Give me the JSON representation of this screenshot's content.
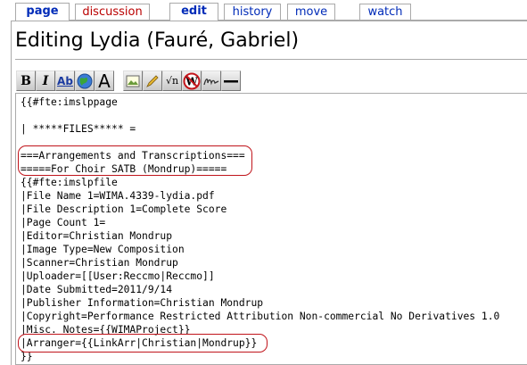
{
  "tabs": [
    {
      "label": "page",
      "state": "active"
    },
    {
      "label": "discussion",
      "state": "redlink"
    },
    {
      "label": "edit",
      "state": "active"
    },
    {
      "label": "history",
      "state": "normal"
    },
    {
      "label": "move",
      "state": "normal"
    },
    {
      "label": "watch",
      "state": "normal"
    }
  ],
  "title": "Editing Lydia (Fauré, Gabriel)",
  "toolbar": {
    "buttons": [
      {
        "name": "bold-button",
        "glyph": "B"
      },
      {
        "name": "italic-button",
        "glyph": "I"
      },
      {
        "name": "internal-link-button",
        "glyph": "Ab"
      },
      {
        "name": "external-link-button",
        "glyph": "globe-icon"
      },
      {
        "name": "headline-button",
        "glyph": "A"
      },
      {
        "name": "embedded-image-button",
        "glyph": "image-icon"
      },
      {
        "name": "media-link-button",
        "glyph": "pencil-icon"
      },
      {
        "name": "math-formula-button",
        "glyph": "√n"
      },
      {
        "name": "nowiki-button",
        "glyph": "W"
      },
      {
        "name": "signature-button",
        "glyph": "signature-icon"
      },
      {
        "name": "horizontal-line-button",
        "glyph": "—"
      }
    ]
  },
  "editor": {
    "lines": [
      "{{#fte:imslppage",
      "",
      "| *****FILES***** =",
      "",
      "===Arrangements and Transcriptions===",
      "=====For Choir SATB (Mondrup)=====",
      "{{#fte:imslpfile",
      "|File Name 1=WIMA.4339-lydia.pdf",
      "|File Description 1=Complete Score",
      "|Page Count 1=",
      "|Editor=Christian Mondrup",
      "|Image Type=New Composition",
      "|Scanner=Christian Mondrup",
      "|Uploader=[[User:Reccmo|Reccmo]]",
      "|Date Submitted=2011/9/14",
      "|Publisher Information=Christian Mondrup",
      "|Copyright=Performance Restricted Attribution Non-commercial No Derivatives 1.0",
      "|Misc. Notes={{WIMAProject}}",
      "|Arranger={{LinkArr|Christian|Mondrup}}",
      "}}"
    ]
  },
  "colors": {
    "link": "#002bb8",
    "redlink": "#ba0000",
    "highlight": "#c0141b",
    "border": "#aaaaaa"
  }
}
